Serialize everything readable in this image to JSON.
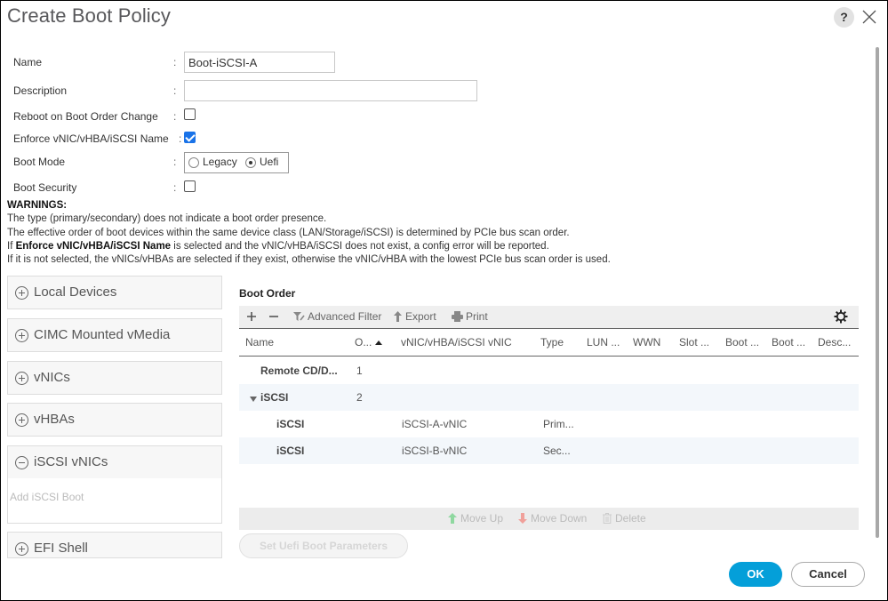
{
  "dialog": {
    "title": "Create Boot Policy",
    "help_label": "?",
    "help_icon": "question-icon",
    "close_icon": "close-icon"
  },
  "form": {
    "name_label": "Name",
    "name_value": "Boot-iSCSI-A",
    "description_label": "Description",
    "description_value": "",
    "reboot_label": "Reboot on Boot Order Change",
    "reboot_checked": false,
    "enforce_label": "Enforce vNIC/vHBA/iSCSI Name",
    "enforce_checked": true,
    "boot_mode_label": "Boot Mode",
    "boot_mode_options": [
      "Legacy",
      "Uefi"
    ],
    "boot_mode_selected": "Uefi",
    "boot_security_label": "Boot Security",
    "boot_security_checked": false,
    "colon": ":"
  },
  "warnings": {
    "heading": "WARNINGS:",
    "line1": "The type (primary/secondary) does not indicate a boot order presence.",
    "line2": "The effective order of boot devices within the same device class (LAN/Storage/iSCSI) is determined by PCIe bus scan order.",
    "line3_prefix": "If ",
    "line3_bold": "Enforce vNIC/vHBA/iSCSI Name",
    "line3_suffix": " is selected and the vNIC/vHBA/iSCSI does not exist, a config error will be reported.",
    "line4": "If it is not selected, the vNICs/vHBAs are selected if they exist, otherwise the vNIC/vHBA with the lowest PCIe bus scan order is used."
  },
  "devices": [
    {
      "label": "Local Devices",
      "expanded": false
    },
    {
      "label": "CIMC Mounted vMedia",
      "expanded": false
    },
    {
      "label": "vNICs",
      "expanded": false
    },
    {
      "label": "vHBAs",
      "expanded": false
    },
    {
      "label": "iSCSI vNICs",
      "expanded": true,
      "body_link": "Add iSCSI Boot"
    },
    {
      "label": "EFI Shell",
      "expanded": false
    }
  ],
  "boot_order": {
    "title": "Boot Order",
    "toolbar": {
      "add_icon": "plus-icon",
      "remove_icon": "minus-icon",
      "filter_label": "Advanced Filter",
      "export_label": "Export",
      "print_label": "Print",
      "settings_icon": "gear-icon"
    },
    "columns": [
      "Name",
      "O...",
      "vNIC/vHBA/iSCSI vNIC",
      "Type",
      "LUN ...",
      "WWN",
      "Slot ...",
      "Boot ...",
      "Boot ...",
      "Desc..."
    ],
    "sort_column": "O...",
    "sort_direction": "ascending",
    "rows": [
      {
        "name": "Remote CD/D...",
        "order": "1",
        "vnic": "",
        "type": ""
      },
      {
        "name": "iSCSI",
        "order": "2",
        "vnic": "",
        "type": "",
        "expanded": true
      },
      {
        "name": "iSCSI",
        "order": "",
        "vnic": "iSCSI-A-vNIC",
        "type": "Prim..."
      },
      {
        "name": "iSCSI",
        "order": "",
        "vnic": "iSCSI-B-vNIC",
        "type": "Sec..."
      }
    ],
    "actions": {
      "move_up": "Move Up",
      "move_down": "Move Down",
      "delete": "Delete"
    },
    "set_uefi_label": "Set Uefi Boot Parameters"
  },
  "footer": {
    "ok_label": "OK",
    "cancel_label": "Cancel"
  },
  "colors": {
    "primary": "#049fd9",
    "checkbox": "#1a73e8",
    "move_up": "#8fd8a0",
    "move_down": "#f0a09a"
  }
}
